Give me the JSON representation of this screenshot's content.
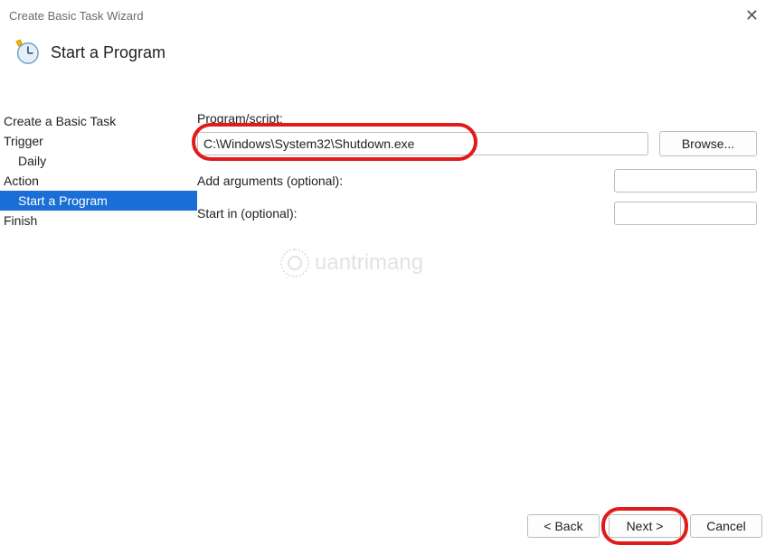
{
  "window": {
    "title": "Create Basic Task Wizard"
  },
  "header": {
    "title": "Start a Program"
  },
  "sidebar": {
    "items": [
      {
        "label": "Create a Basic Task",
        "type": "step"
      },
      {
        "label": "Trigger",
        "type": "step"
      },
      {
        "label": "Daily",
        "type": "substep"
      },
      {
        "label": "Action",
        "type": "step"
      },
      {
        "label": "Start a Program",
        "type": "substep",
        "selected": true
      },
      {
        "label": "Finish",
        "type": "step"
      }
    ]
  },
  "form": {
    "program_label": "Program/script:",
    "program_value": "C:\\Windows\\System32\\Shutdown.exe",
    "browse_label": "Browse...",
    "arguments_label": "Add arguments (optional):",
    "arguments_value": "",
    "startin_label": "Start in (optional):",
    "startin_value": ""
  },
  "footer": {
    "back_label": "< Back",
    "next_label": "Next >",
    "cancel_label": "Cancel"
  },
  "watermark": {
    "text": "uantrimang"
  }
}
